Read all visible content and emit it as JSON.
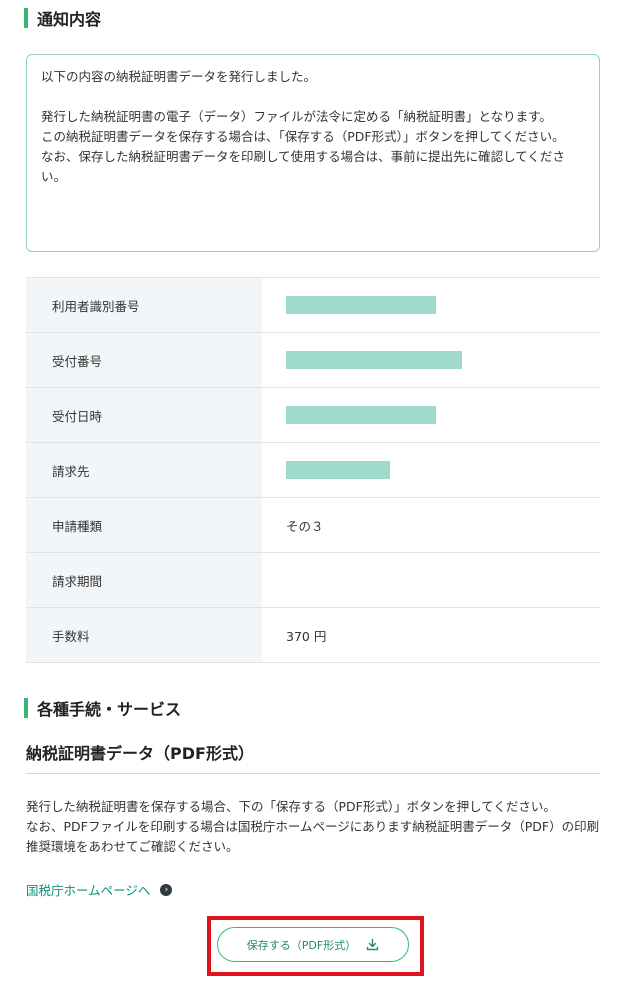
{
  "notice_section": {
    "title": "通知内容",
    "box": {
      "line1": "以下の内容の納税証明書データを発行しました。",
      "line2": "発行した納税証明書の電子（データ）ファイルが法令に定める「納税証明書」となります。",
      "line3": "この納税証明書データを保存する場合は、「保存する（PDF形式）」ボタンを押してください。",
      "line4": "なお、保存した納税証明書データを印刷して使用する場合は、事前に提出先に確認してください。"
    }
  },
  "info_table": {
    "rows": [
      {
        "label": "利用者識別番号",
        "value": "",
        "redacted": true
      },
      {
        "label": "受付番号",
        "value": "",
        "redacted": true
      },
      {
        "label": "受付日時",
        "value": "",
        "redacted": true
      },
      {
        "label": "請求先",
        "value": "",
        "redacted": true
      },
      {
        "label": "申請種類",
        "value": "その３",
        "redacted": false
      },
      {
        "label": "請求期間",
        "value": "",
        "redacted": false
      },
      {
        "label": "手数料",
        "value": "370 円",
        "redacted": false
      }
    ]
  },
  "services_section": {
    "title": "各種手続・サービス",
    "subtitle": "納税証明書データ（PDF形式）",
    "desc_line1": "発行した納税証明書を保存する場合、下の「保存する（PDF形式）」ボタンを押してください。",
    "desc_line2": "なお、PDFファイルを印刷する場合は国税庁ホームページにあります納税証明書データ（PDF）の印刷推奨環境をあわせてご確認ください。",
    "link_label": "国税庁ホームページへ",
    "save_button_label": "保存する（PDF形式）"
  },
  "colors": {
    "accent_green": "#3cb371",
    "redaction": "#9fd9cb",
    "highlight_red": "#e0141e",
    "link": "#0b8f7a"
  },
  "icons": {
    "link_arrow": "chevron-right-circle-icon",
    "button": "download-icon"
  }
}
